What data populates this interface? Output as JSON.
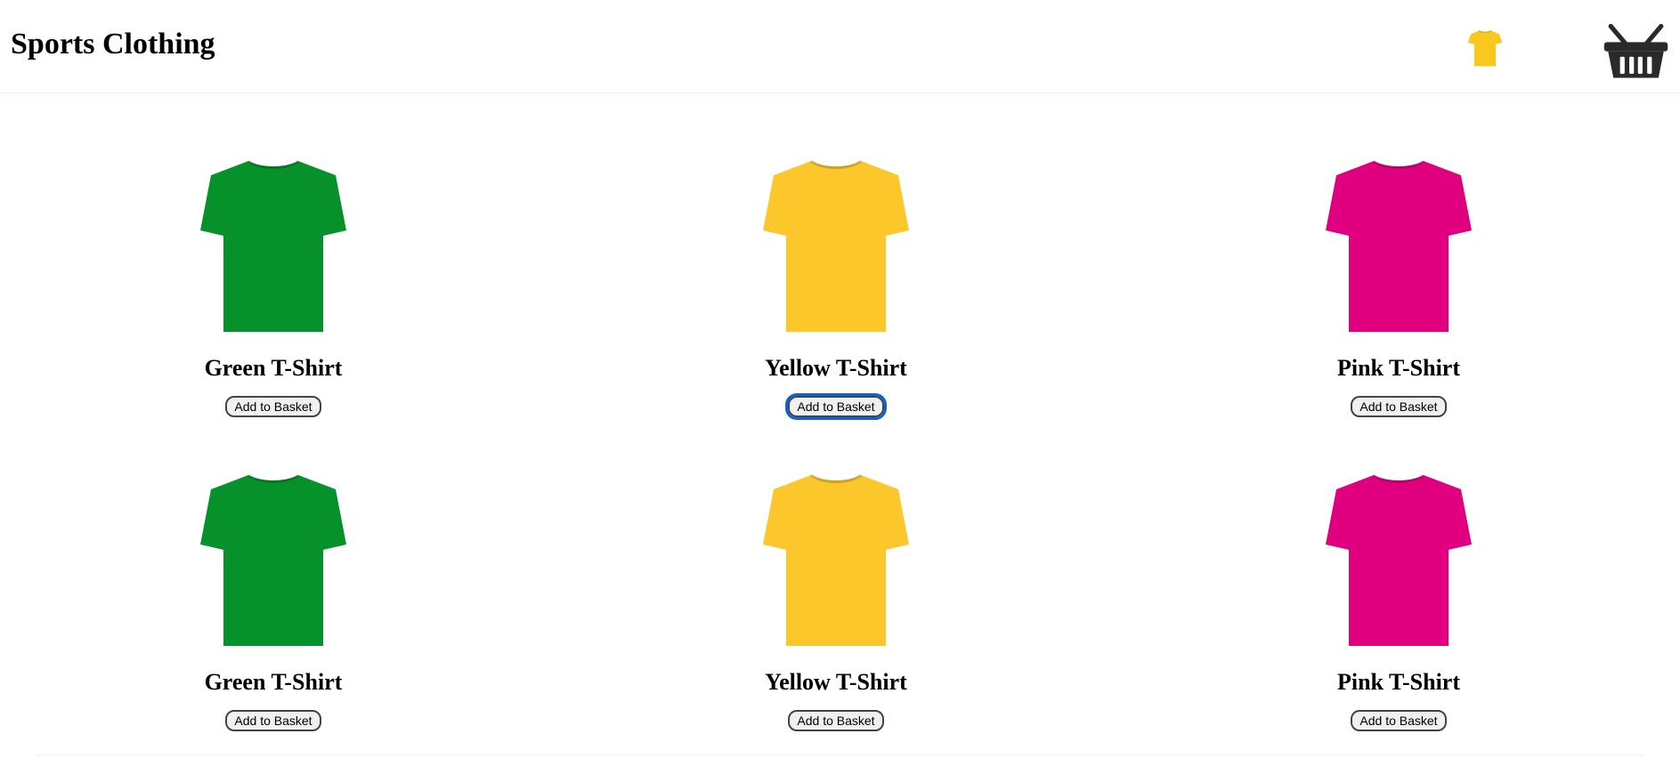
{
  "header": {
    "title": "Sports Clothing",
    "mini_item_icon": "yellow-tshirt-icon",
    "basket_icon": "basket-icon",
    "mini_item_color": "#f9c81f"
  },
  "colors": {
    "green": "#06912a",
    "yellow": "#fbc72a",
    "pink": "#e0007f",
    "focus_ring": "#0a64d6"
  },
  "products": [
    {
      "name": "Green T-Shirt",
      "button": "Add to Basket",
      "color": "#06912a",
      "icon": "green-tshirt-icon"
    },
    {
      "name": "Yellow T-Shirt",
      "button": "Add to Basket",
      "color": "#fbc72a",
      "icon": "yellow-tshirt-icon",
      "focused": true
    },
    {
      "name": "Pink T-Shirt",
      "button": "Add to Basket",
      "color": "#e0007f",
      "icon": "pink-tshirt-icon"
    },
    {
      "name": "Green T-Shirt",
      "button": "Add to Basket",
      "color": "#06912a",
      "icon": "green-tshirt-icon"
    },
    {
      "name": "Yellow T-Shirt",
      "button": "Add to Basket",
      "color": "#fbc72a",
      "icon": "yellow-tshirt-icon"
    },
    {
      "name": "Pink T-Shirt",
      "button": "Add to Basket",
      "color": "#e0007f",
      "icon": "pink-tshirt-icon"
    }
  ]
}
